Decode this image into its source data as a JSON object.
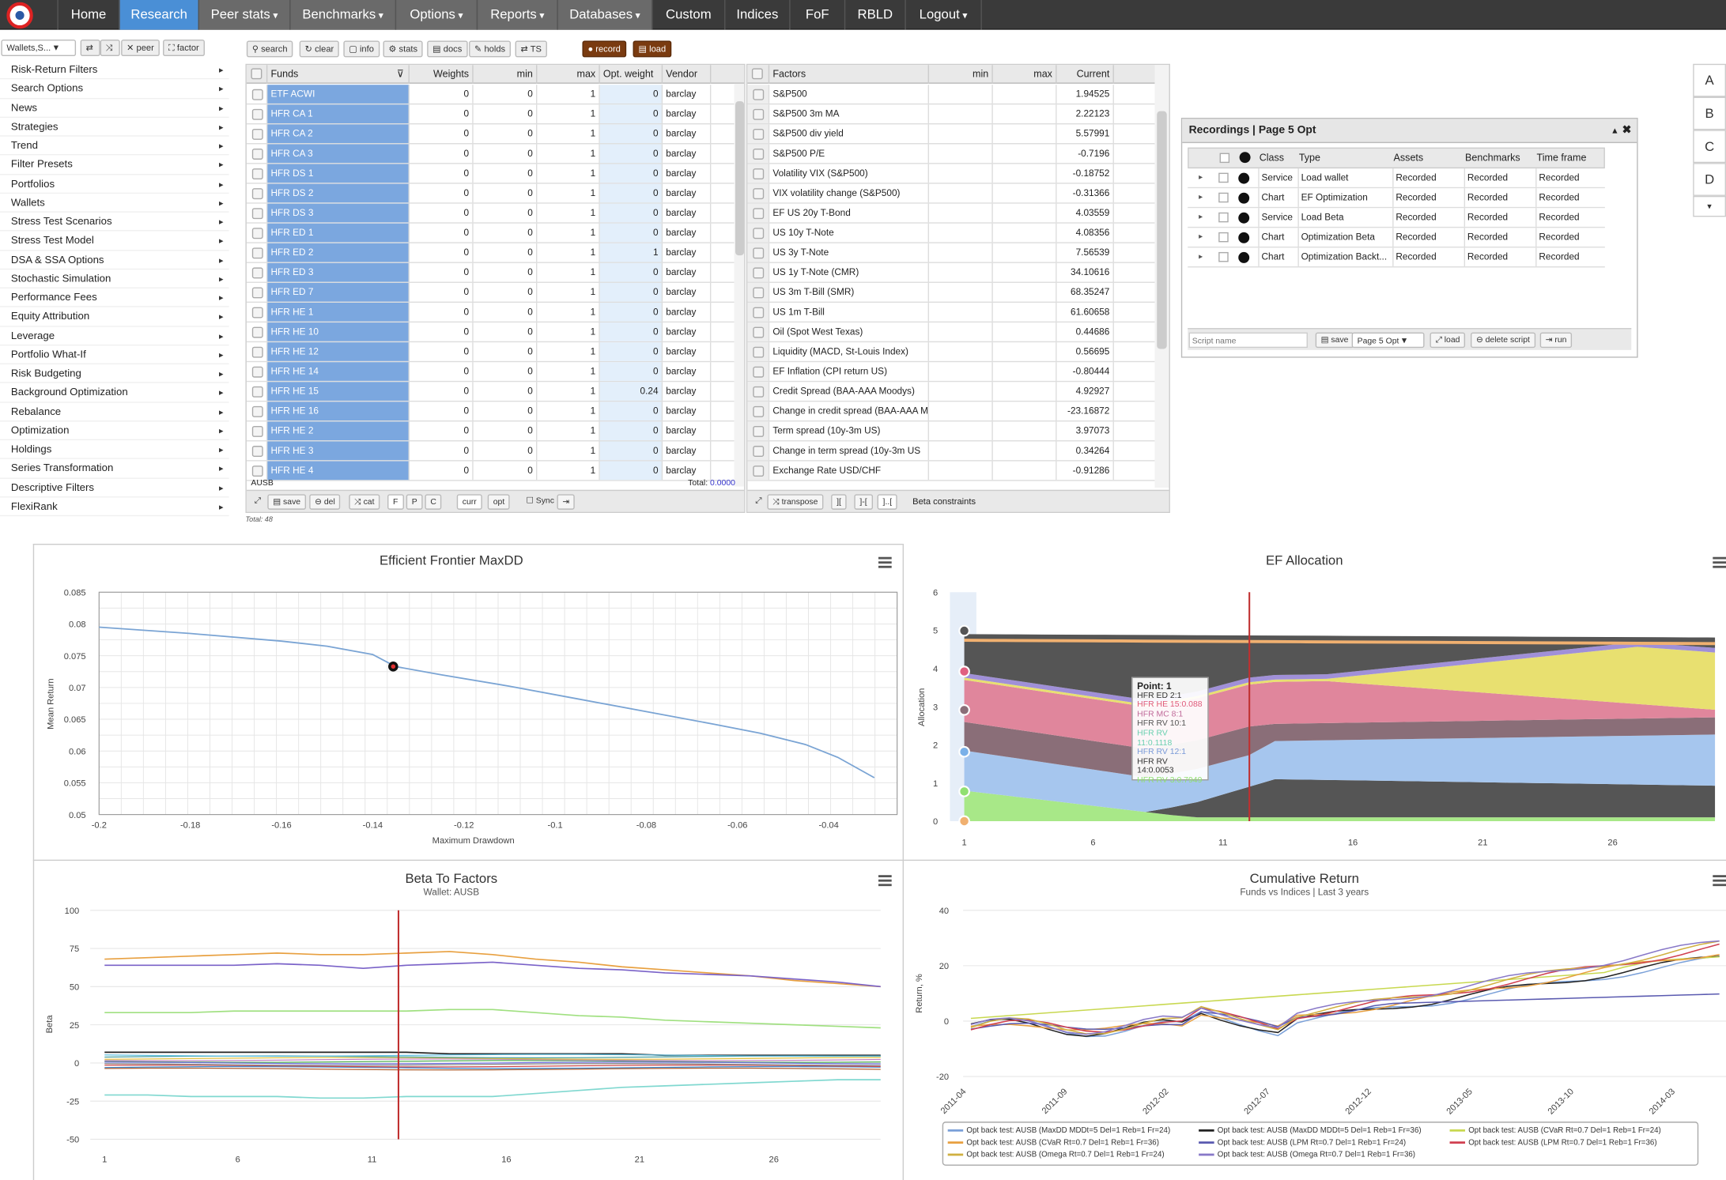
{
  "nav": {
    "items": [
      "Home",
      "Research",
      "Peer stats",
      "Benchmarks",
      "Options",
      "Reports",
      "Databases",
      "Custom",
      "Indices",
      "FoF",
      "RBLD",
      "Logout"
    ]
  },
  "toolbar": {
    "wallet_select": "Wallets,S...",
    "peer": "peer",
    "factor": "factor",
    "search": "search",
    "clear": "clear",
    "info": "info",
    "stats": "stats",
    "docs": "docs",
    "holds": "holds",
    "ts": "TS",
    "record": "record",
    "load": "load"
  },
  "menu": [
    "Risk-Return Filters",
    "Search Options",
    "News",
    "Strategies",
    "Trend",
    "Filter Presets",
    "Portfolios",
    "Wallets",
    "Stress Test Scenarios",
    "Stress Test Model",
    "DSA & SSA Options",
    "Stochastic Simulation",
    "Performance Fees",
    "Equity Attribution",
    "Leverage",
    "Portfolio What-If",
    "Risk Budgeting",
    "Background Optimization",
    "Rebalance",
    "Optimization",
    "Holdings",
    "Series Transformation",
    "Descriptive Filters",
    "FlexiRank"
  ],
  "funds": {
    "headers": [
      "Funds",
      "Weights",
      "min",
      "max",
      "Opt. weight",
      "Vendor"
    ],
    "rows": [
      [
        "ETF ACWI",
        "0",
        "0",
        "1",
        "0",
        "barclay"
      ],
      [
        "HFR CA 1",
        "0",
        "0",
        "1",
        "0",
        "barclay"
      ],
      [
        "HFR CA 2",
        "0",
        "0",
        "1",
        "0",
        "barclay"
      ],
      [
        "HFR CA 3",
        "0",
        "0",
        "1",
        "0",
        "barclay"
      ],
      [
        "HFR DS 1",
        "0",
        "0",
        "1",
        "0",
        "barclay"
      ],
      [
        "HFR DS 2",
        "0",
        "0",
        "1",
        "0",
        "barclay"
      ],
      [
        "HFR DS 3",
        "0",
        "0",
        "1",
        "0",
        "barclay"
      ],
      [
        "HFR ED 1",
        "0",
        "0",
        "1",
        "0",
        "barclay"
      ],
      [
        "HFR ED 2",
        "0",
        "0",
        "1",
        "1",
        "barclay"
      ],
      [
        "HFR ED 3",
        "0",
        "0",
        "1",
        "0",
        "barclay"
      ],
      [
        "HFR ED 7",
        "0",
        "0",
        "1",
        "0",
        "barclay"
      ],
      [
        "HFR HE 1",
        "0",
        "0",
        "1",
        "0",
        "barclay"
      ],
      [
        "HFR HE 10",
        "0",
        "0",
        "1",
        "0",
        "barclay"
      ],
      [
        "HFR HE 12",
        "0",
        "0",
        "1",
        "0",
        "barclay"
      ],
      [
        "HFR HE 14",
        "0",
        "0",
        "1",
        "0",
        "barclay"
      ],
      [
        "HFR HE 15",
        "0",
        "0",
        "1",
        "0.24",
        "barclay"
      ],
      [
        "HFR HE 16",
        "0",
        "0",
        "1",
        "0",
        "barclay"
      ],
      [
        "HFR HE 2",
        "0",
        "0",
        "1",
        "0",
        "barclay"
      ],
      [
        "HFR HE 3",
        "0",
        "0",
        "1",
        "0",
        "barclay"
      ],
      [
        "HFR HE 4",
        "0",
        "0",
        "1",
        "0",
        "barclay"
      ]
    ],
    "wallet": "AUSB",
    "total_label": "Total:",
    "total_value": "0.0000",
    "total_count": "Total: 48",
    "footer": {
      "save": "save",
      "del": "del",
      "cat": "cat",
      "f": "F",
      "p": "P",
      "c": "C",
      "curr": "curr",
      "opt": "opt",
      "sync": "Sync"
    }
  },
  "factors": {
    "headers": [
      "Factors",
      "min",
      "max",
      "Current"
    ],
    "rows": [
      [
        "S&P500",
        "1.94525"
      ],
      [
        "S&P500 3m MA",
        "2.22123"
      ],
      [
        "S&P500 div yield",
        "5.57991"
      ],
      [
        "S&P500 P/E",
        "-0.7196"
      ],
      [
        "Volatility VIX (S&P500)",
        "-0.18752"
      ],
      [
        "VIX volatility change (S&P500)",
        "-0.31366"
      ],
      [
        "EF US 20y T-Bond",
        "4.03559"
      ],
      [
        "US 10y T-Note",
        "4.08356"
      ],
      [
        "US 3y T-Note",
        "7.56539"
      ],
      [
        "US 1y T-Note (CMR)",
        "34.10616"
      ],
      [
        "US 3m T-Bill (SMR)",
        "68.35247"
      ],
      [
        "US 1m T-Bill",
        "61.60658"
      ],
      [
        "Oil (Spot West Texas)",
        "0.44686"
      ],
      [
        "Liquidity (MACD, St-Louis Index)",
        "0.56695"
      ],
      [
        "EF Inflation (CPI return US)",
        "-0.80444"
      ],
      [
        "Credit Spread (BAA-AAA Moodys)",
        "4.92927"
      ],
      [
        "Change in credit spread (BAA-AAA M",
        "-23.16872"
      ],
      [
        "Term spread (10y-3m US)",
        "3.97073"
      ],
      [
        "Change in term spread (10y-3m US",
        "0.34264"
      ],
      [
        "Exchange Rate USD/CHF",
        "-0.91286"
      ]
    ],
    "footer": {
      "transpose": "transpose",
      "beta": "Beta constraints"
    }
  },
  "recordings": {
    "title": "Recordings | Page 5 Opt",
    "headers": [
      "Class",
      "Type",
      "Assets",
      "Benchmarks",
      "Time frame"
    ],
    "rows": [
      [
        "Service",
        "Load wallet",
        "Recorded",
        "Recorded",
        "Recorded"
      ],
      [
        "Chart",
        "EF Optimization",
        "Recorded",
        "Recorded",
        "Recorded"
      ],
      [
        "Service",
        "Load Beta",
        "Recorded",
        "Recorded",
        "Recorded"
      ],
      [
        "Chart",
        "Optimization Beta",
        "Recorded",
        "Recorded",
        "Recorded"
      ],
      [
        "Chart",
        "Optimization Backt...",
        "Recorded",
        "Recorded",
        "Recorded"
      ]
    ],
    "script_placeholder": "Script name",
    "save": "save",
    "page_select": "Page 5 Opt",
    "load": "load",
    "delete": "delete script",
    "run": "run"
  },
  "side_tabs": [
    "A",
    "B",
    "C",
    "D"
  ],
  "colors": {
    "nav_bg": "#3a3a3a",
    "nav_active": "#4a8fd6",
    "record": "#7a3b10",
    "fund_cell": "#7ba7df"
  },
  "chart_data": [
    {
      "type": "line",
      "title": "Efficient Frontier MaxDD",
      "xlabel": "Maximum Drawdown",
      "ylabel": "Mean Return",
      "xlim": [
        -0.2,
        -0.025
      ],
      "ylim": [
        0.05,
        0.085
      ],
      "xticks": [
        "-0.2",
        "-0.18",
        "-0.16",
        "-0.14",
        "-0.12",
        "-0.1",
        "-0.08",
        "-0.06",
        "-0.04"
      ],
      "yticks": [
        "0.085",
        "0.08",
        "0.075",
        "0.07",
        "0.065",
        "0.06",
        "0.055",
        "0.05"
      ],
      "x": [
        -0.2,
        -0.18,
        -0.16,
        -0.15,
        -0.14,
        -0.135,
        -0.125,
        -0.11,
        -0.095,
        -0.08,
        -0.065,
        -0.055,
        -0.045,
        -0.038,
        -0.03
      ],
      "y": [
        0.0795,
        0.0785,
        0.0773,
        0.0765,
        0.0752,
        0.0733,
        0.072,
        0.0702,
        0.0682,
        0.0662,
        0.0642,
        0.0628,
        0.061,
        0.059,
        0.0558
      ],
      "highlight": {
        "x": -0.1355,
        "y": 0.0733
      }
    },
    {
      "type": "area",
      "title": "EF Allocation",
      "ylabel": "Allocation",
      "ylim": [
        0,
        6
      ],
      "yticks": [
        "6",
        "5",
        "4",
        "3",
        "2",
        "1",
        "0"
      ],
      "xticks": [
        "1",
        "6",
        "11",
        "16",
        "21",
        "26"
      ],
      "tooltip": {
        "title": "Point: 1",
        "lines": [
          {
            "text": "HFR ED 2:1",
            "color": "#333"
          },
          {
            "text": "HFR HE 15:0.088",
            "color": "#e05a7a"
          },
          {
            "text": "HFR MC 8:1",
            "color": "#c06a9a"
          },
          {
            "text": "HFR RV 10:1",
            "color": "#555"
          },
          {
            "text": "HFR RV 11:0.1118",
            "color": "#6ad0b0"
          },
          {
            "text": "HFR RV 12:1",
            "color": "#7a9ad8"
          },
          {
            "text": "HFR RV 14:0.0053",
            "color": "#333"
          },
          {
            "text": "HFR RV 3:0.7949",
            "color": "#90e070"
          }
        ]
      }
    },
    {
      "type": "line",
      "title": "Beta To Factors",
      "subtitle": "Wallet: AUSB",
      "ylabel": "Beta",
      "ylim": [
        -50,
        100
      ],
      "yticks": [
        "100",
        "75",
        "50",
        "25",
        "0",
        "-25",
        "-50"
      ],
      "xticks": [
        "1",
        "6",
        "11",
        "16",
        "21",
        "26"
      ],
      "series": [
        {
          "color": "#e8a040",
          "values": [
            68,
            69,
            70,
            71,
            72,
            71,
            71,
            72,
            73,
            71,
            68,
            66,
            63,
            61,
            59,
            57,
            54,
            52,
            50
          ]
        },
        {
          "color": "#7a62c8",
          "values": [
            64,
            64,
            64,
            64,
            65,
            64,
            62,
            64,
            65,
            66,
            64,
            62,
            61,
            59,
            58,
            57,
            55,
            53,
            50
          ]
        },
        {
          "color": "#a0e080",
          "values": [
            33,
            33,
            33,
            34,
            34,
            34,
            34,
            34,
            35,
            35,
            33,
            31,
            30,
            28,
            27,
            26,
            25,
            24,
            23
          ]
        },
        {
          "color": "#80d8d0",
          "values": [
            -21,
            -21,
            -22,
            -22,
            -22,
            -23,
            -23,
            -22,
            -22,
            -22,
            -20,
            -18,
            -16,
            -15,
            -14,
            -13,
            -12,
            -11,
            -11
          ]
        },
        {
          "color": "#222",
          "values": [
            7,
            7,
            7,
            7,
            7,
            7,
            7,
            7,
            6,
            6,
            6,
            6,
            6,
            5,
            5,
            5,
            5,
            5,
            5
          ]
        }
      ]
    },
    {
      "type": "line",
      "title": "Cumulative Return",
      "subtitle": "Funds vs Indices | Last 3 years",
      "ylabel": "Return, %",
      "ylim": [
        -20,
        40
      ],
      "yticks": [
        "40",
        "20",
        "0",
        "-20"
      ],
      "xticks": [
        "2011-04",
        "2011-09",
        "2012-02",
        "2012-07",
        "2012-12",
        "2013-05",
        "2013-10",
        "2014-03"
      ],
      "legend": [
        "Opt back test: AUSB (MaxDD MDDt=5 Del=1 Reb=1 Fr=24)",
        "Opt back test: AUSB (MaxDD MDDt=5 Del=1 Reb=1 Fr=36)",
        "Opt back test: AUSB (CVaR Rt=0.7 Del=1 Reb=1 Fr=24)",
        "Opt back test: AUSB (CVaR Rt=0.7 Del=1 Reb=1 Fr=36)",
        "Opt back test: AUSB (LPM Rt=0.7 Del=1 Reb=1 Fr=24)",
        "Opt back test: AUSB (LPM Rt=0.7 Del=1 Reb=1 Fr=36)",
        "Opt back test: AUSB (Omega Rt=0.7 Del=1 Reb=1 Fr=24)",
        "Opt back test: AUSB (Omega Rt=0.7 Del=1 Reb=1 Fr=36)"
      ],
      "legend_colors": [
        "#7aa0d8",
        "#222",
        "#c8d850",
        "#e8a040",
        "#5a5ab0",
        "#d04050",
        "#d0b040",
        "#8878c8"
      ]
    }
  ]
}
